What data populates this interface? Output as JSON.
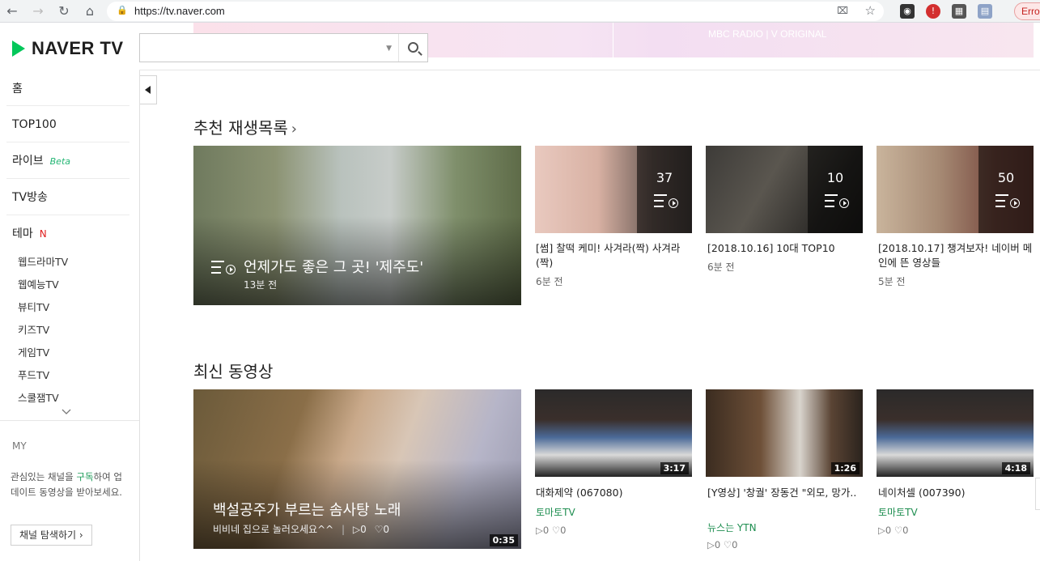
{
  "browser": {
    "url": "https://tv.naver.com",
    "error_label": "Error"
  },
  "header": {
    "logo_text": "NAVER TV",
    "search_placeholder": "",
    "banner_text": "MBC RADIO  |  V ORIGINAL"
  },
  "sidebar": {
    "items": [
      {
        "label": "홈"
      },
      {
        "label": "TOP100"
      },
      {
        "label": "라이브",
        "badge": "Beta"
      },
      {
        "label": "TV방송"
      },
      {
        "label": "테마",
        "badge": "N"
      }
    ],
    "sub_items": [
      "웹드라마TV",
      "웹예능TV",
      "뷰티TV",
      "키즈TV",
      "게임TV",
      "푸드TV",
      "스쿨잼TV"
    ],
    "my": {
      "title": "MY",
      "desc_pre": "관심있는 채널을 ",
      "desc_highlight": "구독",
      "desc_post": "하여 업데이트 동영상을 받아보세요.",
      "button_label": "채널 탐색하기"
    }
  },
  "recommended": {
    "title": "추천 재생목록",
    "featured": {
      "title": "언제가도 좋은 그 곳! '제주도'",
      "time": "13분 전"
    },
    "items": [
      {
        "count": "37",
        "title": "[썸] 찰떡 케미! 사겨라(짝) 사겨라(짝)",
        "time": "6분 전"
      },
      {
        "count": "10",
        "title": "[2018.10.16] 10대 TOP10",
        "time": "6분 전"
      },
      {
        "count": "50",
        "title": "[2018.10.17] 챙겨보자! 네이버 메인에 뜬 영상들",
        "time": "5분 전"
      }
    ]
  },
  "latest": {
    "title": "최신 동영상",
    "featured": {
      "title": "백설공주가 부르는 솜사탕 노래",
      "channel": "비비네 집으로 놀러오세요^^",
      "plays": "0",
      "likes": "0",
      "duration": "0:35"
    },
    "items": [
      {
        "title": "대화제약 (067080)",
        "channel": "토마토TV",
        "plays": "0",
        "likes": "0",
        "duration": "3:17"
      },
      {
        "title": "[Y영상] '창궐' 장동건 \"외모, 망가..",
        "channel": "뉴스는 YTN",
        "plays": "0",
        "likes": "0",
        "duration": "1:26"
      },
      {
        "title": "네이처셀 (007390)",
        "channel": "토마토TV",
        "plays": "0",
        "likes": "0",
        "duration": "4:18"
      }
    ]
  },
  "colors": {
    "brand_green": "#03c75a",
    "channel_green": "#1e8e50"
  }
}
